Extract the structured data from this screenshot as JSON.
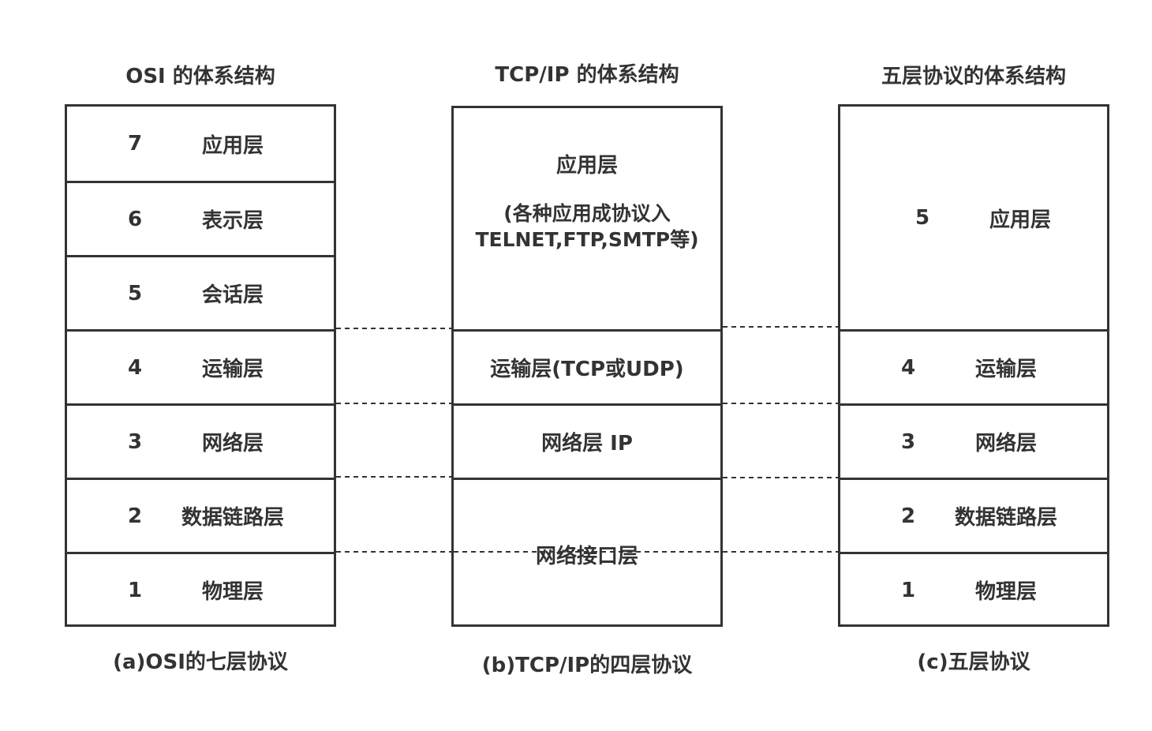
{
  "osi": {
    "title": "OSI 的体系结构",
    "caption": "(a)OSI的七层协议",
    "layers": [
      {
        "num": "7",
        "name": "应用层"
      },
      {
        "num": "6",
        "name": "表示层"
      },
      {
        "num": "5",
        "name": "会话层"
      },
      {
        "num": "4",
        "name": "运输层"
      },
      {
        "num": "3",
        "name": "网络层"
      },
      {
        "num": "2",
        "name": "数据链路层"
      },
      {
        "num": "1",
        "name": "物理层"
      }
    ]
  },
  "tcpip": {
    "title": "TCP/IP 的体系结构",
    "caption": "(b)TCP/IP的四层协议",
    "app_name": "应用层",
    "app_desc_line1": "(各种应用成协议入",
    "app_desc_line2": "TELNET,FTP,SMTP等)",
    "transport": "运输层(TCP或UDP)",
    "network": "网络层 IP",
    "interface": "网络接口层"
  },
  "five": {
    "title": "五层协议的体系结构",
    "caption": "(c)五层协议",
    "layers": [
      {
        "num": "5",
        "name": "应用层"
      },
      {
        "num": "4",
        "name": "运输层"
      },
      {
        "num": "3",
        "name": "网络层"
      },
      {
        "num": "2",
        "name": "数据链路层"
      },
      {
        "num": "1",
        "name": "物理层"
      }
    ]
  }
}
